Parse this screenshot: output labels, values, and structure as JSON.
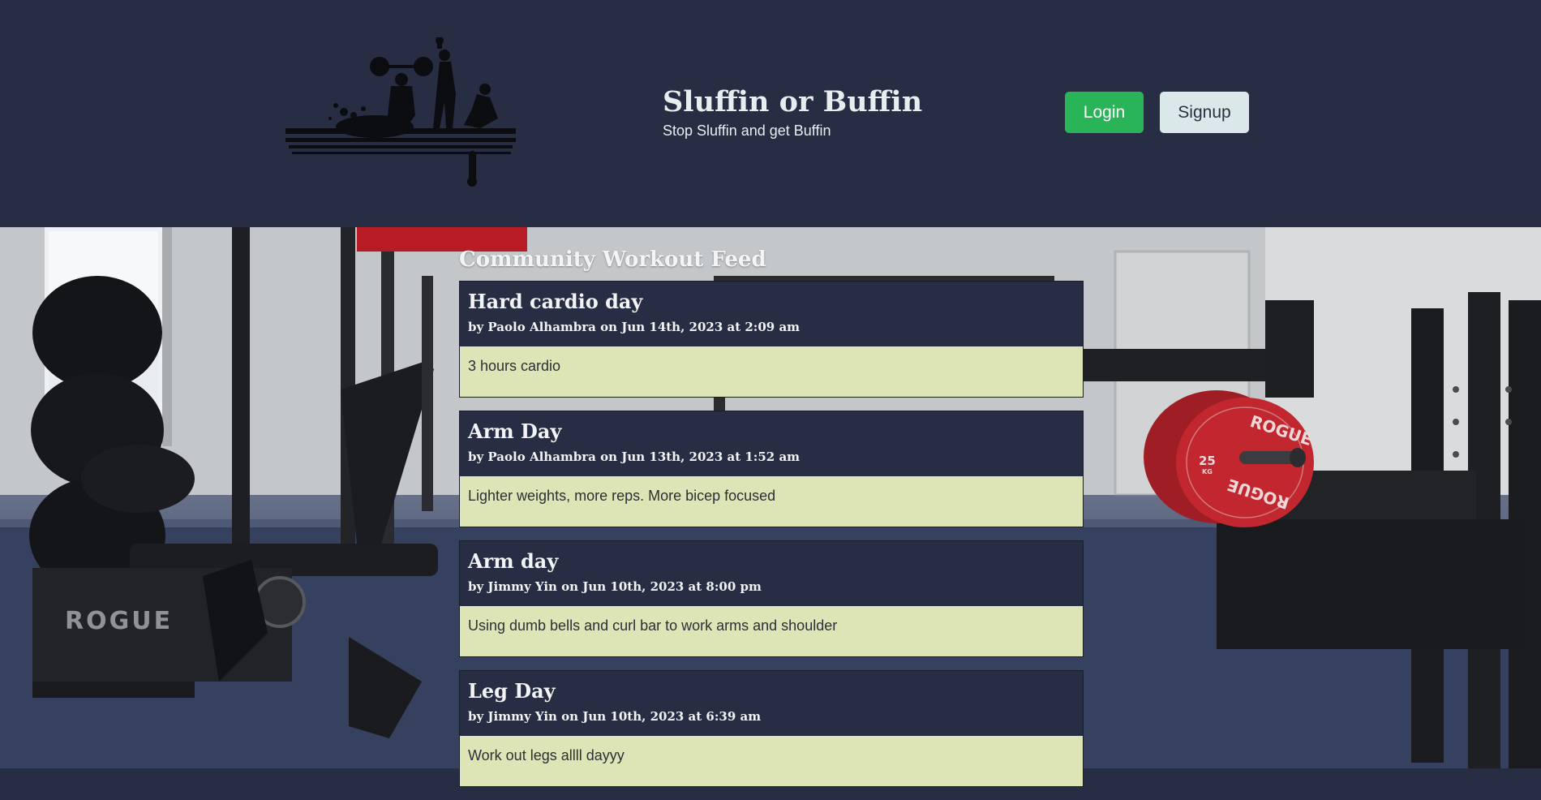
{
  "header": {
    "title": "Sluffin or Buffin",
    "tagline": "Stop Sluffin and get Buffin",
    "login_label": "Login",
    "signup_label": "Signup"
  },
  "background": {
    "brand_text": "ROGUE",
    "plate_weight": "25",
    "plate_unit": "KG",
    "plate_label_top": "ROGUE",
    "plate_label_bottom": "ROGUE"
  },
  "feed": {
    "heading": "Community Workout Feed",
    "posts": [
      {
        "title": "Hard cardio day",
        "meta": "by Paolo Alhambra on Jun 14th, 2023 at 2:09 am",
        "body": "3 hours cardio"
      },
      {
        "title": "Arm Day",
        "meta": "by Paolo Alhambra on Jun 13th, 2023 at 1:52 am",
        "body": "Lighter weights, more reps. More bicep focused"
      },
      {
        "title": "Arm day",
        "meta": "by Jimmy Yin on Jun 10th, 2023 at 8:00 pm",
        "body": "Using dumb bells and curl bar to work arms and shoulder"
      },
      {
        "title": "Leg Day",
        "meta": "by Jimmy Yin on Jun 10th, 2023 at 6:39 am",
        "body": "Work out legs allll dayyy"
      }
    ]
  },
  "colors": {
    "header_bg": "#272d42",
    "login_bg": "#29b458",
    "signup_bg": "#dbe8ea",
    "post_body_bg": "#dde5b6",
    "plate_red": "#c2262e"
  }
}
